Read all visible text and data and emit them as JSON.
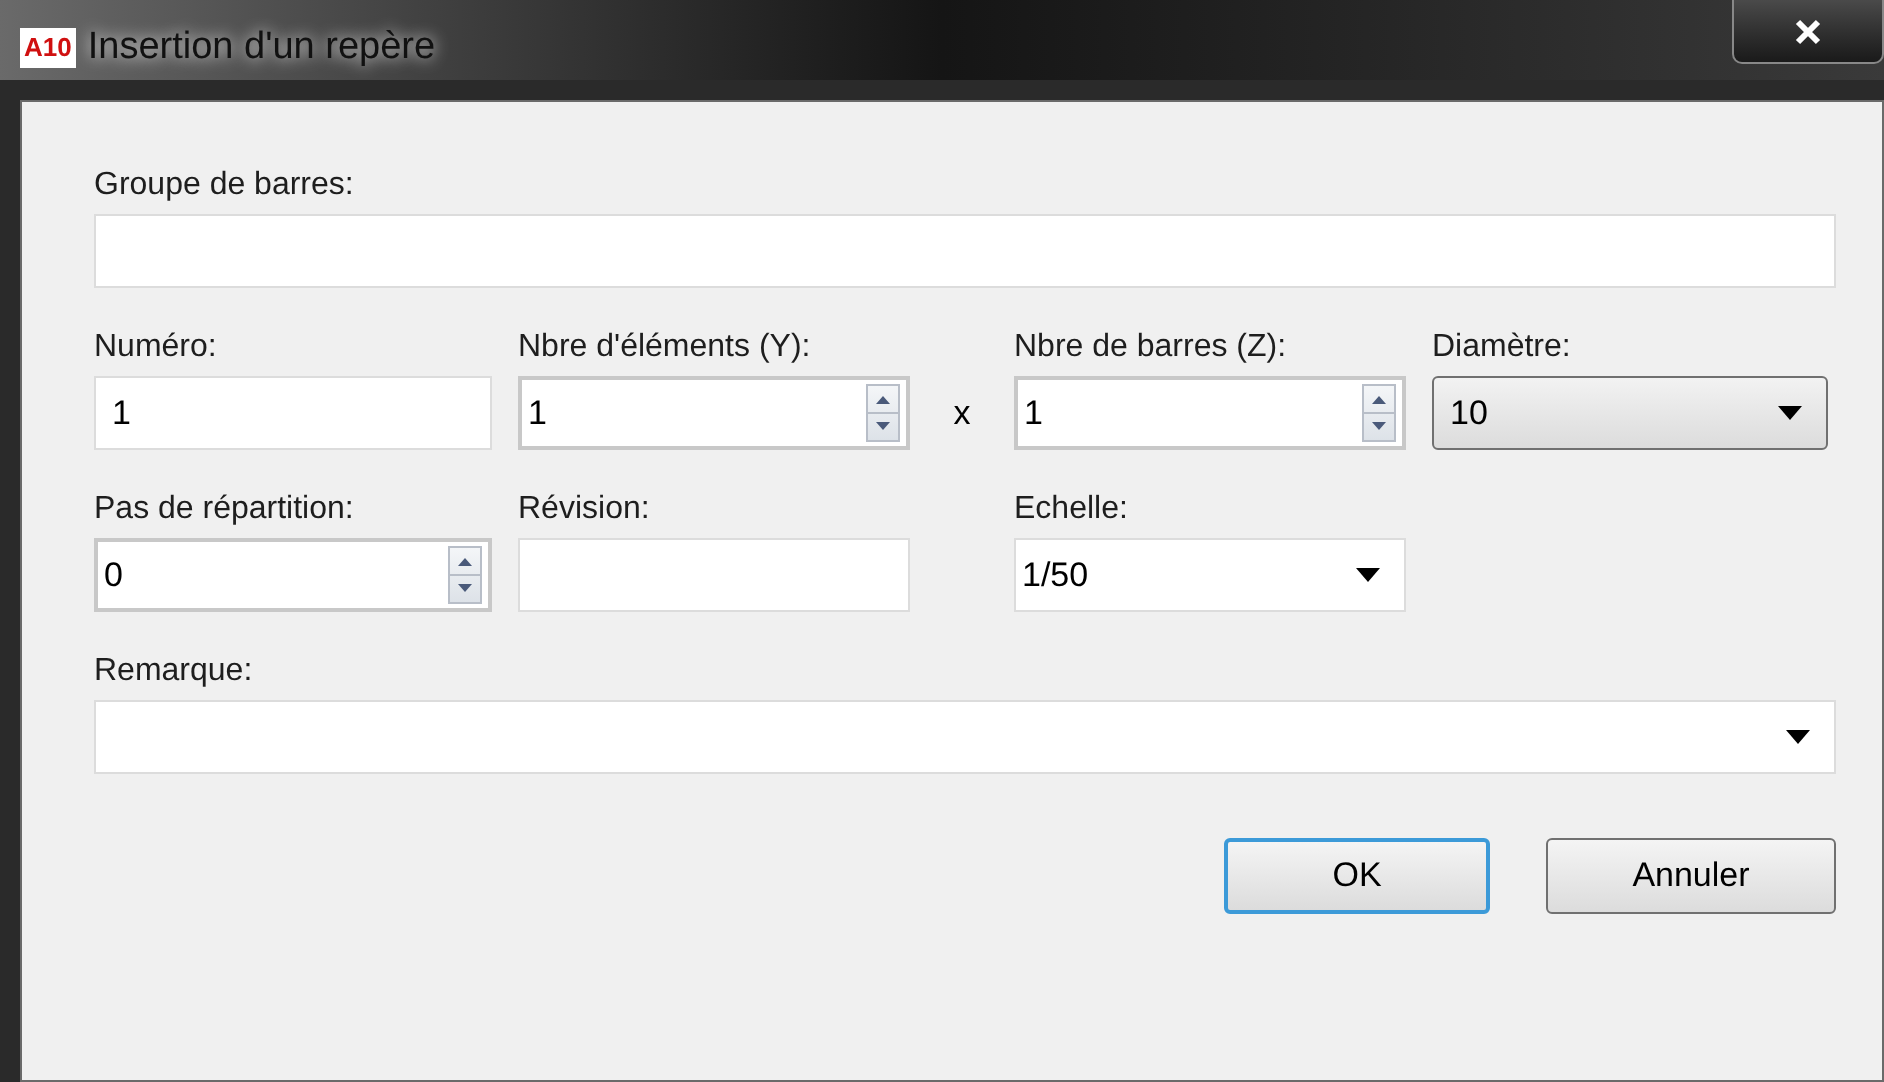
{
  "window": {
    "title": "Insertion d'un repère",
    "icon_text": "A10"
  },
  "rows": [
    {
      "fields": [
        {
          "kind": "text",
          "label": "Groupe de barres:"
        }
      ]
    },
    {
      "fields": [
        {
          "kind": "text",
          "label": "Numéro:",
          "value": "1"
        },
        {
          "kind": "spin",
          "label": "Nbre d'éléments (Y):",
          "value": "1"
        },
        {
          "kind": "operator",
          "text": "x"
        },
        {
          "kind": "spin",
          "label": "Nbre de barres (Z):",
          "value": "1"
        },
        {
          "kind": "select",
          "label": "Diamètre:",
          "value": "10"
        }
      ]
    },
    {
      "fields": [
        {
          "kind": "spin",
          "label": "Pas de répartition:",
          "value": "0"
        },
        {
          "kind": "text",
          "label": "Révision:"
        },
        {
          "kind": "combo",
          "label": "Echelle:",
          "value": "1/50"
        }
      ]
    },
    {
      "fields": [
        {
          "kind": "combo",
          "label": "Remarque:"
        }
      ]
    }
  ],
  "buttons": [
    {
      "label": "OK",
      "focused": true
    },
    {
      "label": "Annuler",
      "focused": false
    }
  ]
}
